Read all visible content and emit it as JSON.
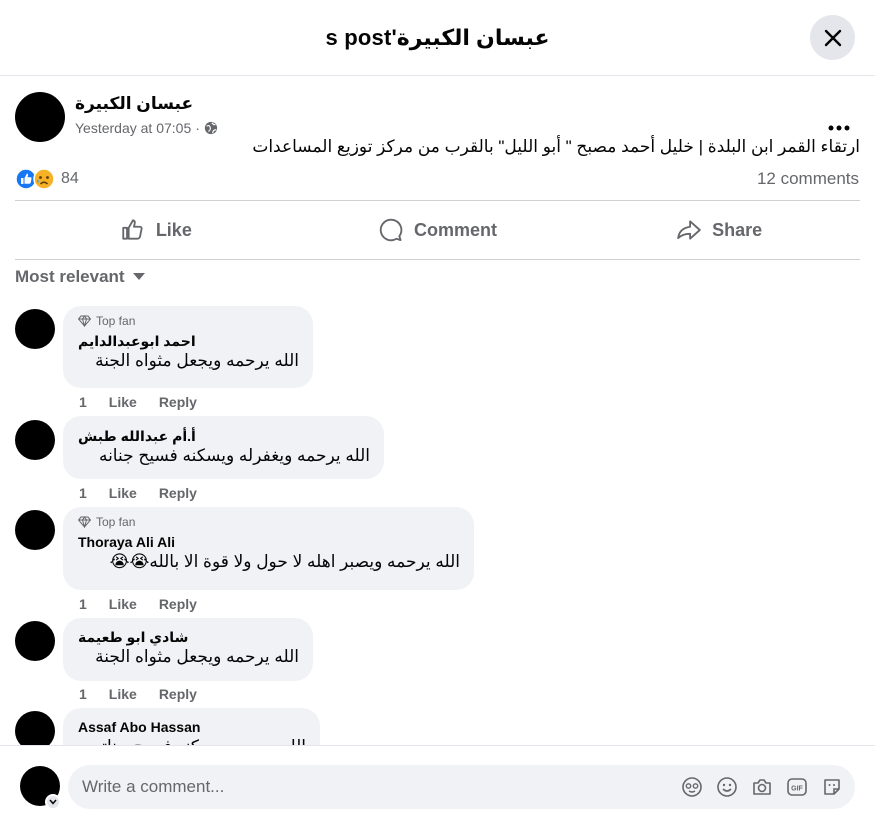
{
  "dialog": {
    "title": "عبسان الكبيرة's post"
  },
  "post": {
    "author": "عبسان الكبيرة",
    "time": "Yesterday at 07:05",
    "separator": "·",
    "text": "ارتقاء القمر ابن البلدة | خليل أحمد مصبح \" أبو الليل\" بالقرب من مركز توزيع المساعدات",
    "reactions_count": "84",
    "comments_count": "12 comments"
  },
  "actions": {
    "like": "Like",
    "comment": "Comment",
    "share": "Share"
  },
  "sort": {
    "label": "Most relevant"
  },
  "comments": [
    {
      "badge": "Top fan",
      "name": "احمد ابوعبدالدايم",
      "text": "الله يرحمه ويجعل مثواه الجنة",
      "time": "1",
      "like": "Like",
      "reply": "Reply"
    },
    {
      "badge": "",
      "name": "أ.أم عبدالله طبش",
      "text": "الله يرحمه ويغفرله ويسكنه فسيح جنانه",
      "time": "1",
      "like": "Like",
      "reply": "Reply"
    },
    {
      "badge": "Top fan",
      "name": "Thoraya Ali Ali",
      "text": "الله يرحمه ويصبر اهله لا حول ولا قوة الا بالله😭😭",
      "time": "1",
      "like": "Like",
      "reply": "Reply"
    },
    {
      "badge": "",
      "name": "شادي ابو طعيمة",
      "text": "الله يرحمه ويجعل مثواه الجنة",
      "time": "1",
      "like": "Like",
      "reply": "Reply"
    },
    {
      "badge": "",
      "name": "Assaf Abo Hassan",
      "text": "الله يرحمه ويسكنه فسيح جناته",
      "time": "",
      "like": "",
      "reply": ""
    }
  ],
  "composer": {
    "placeholder": "Write a comment..."
  },
  "icons": {
    "close": "close-icon",
    "more": "more-horizontal-icon",
    "audience": "globe-icon",
    "like_reaction": "like-reaction-icon",
    "sad_reaction": "sad-reaction-icon",
    "top_fan": "diamond-icon",
    "composer": [
      "avatar-sticker-icon",
      "emoji-icon",
      "camera-icon",
      "gif-icon",
      "sticker-icon"
    ]
  },
  "colors": {
    "accent": "#1877f2",
    "secondary_text": "#65676b",
    "bubble": "#f0f2f5",
    "sad": "#f7b125"
  }
}
